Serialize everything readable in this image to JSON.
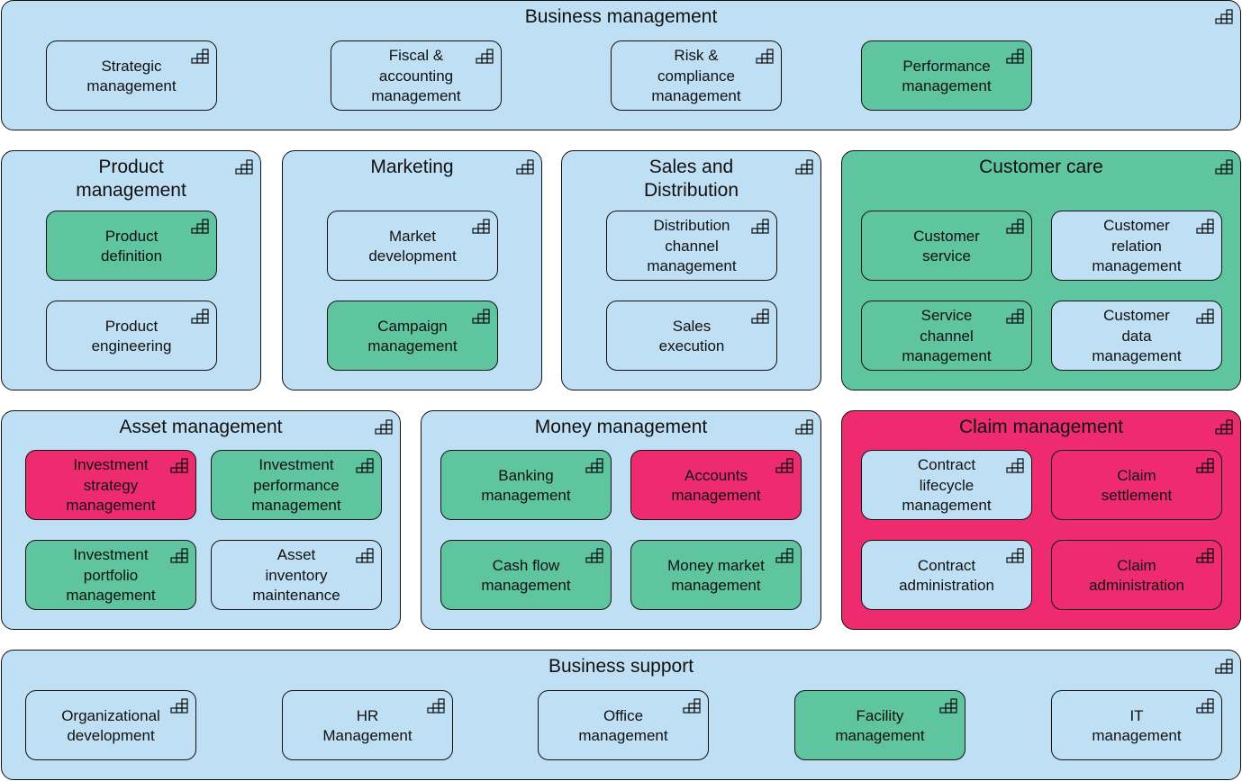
{
  "colors": {
    "default": "#bfe0f4",
    "highlight_green": "#5fc4a0",
    "highlight_red": "#ee2b6f"
  },
  "icon": "capability-staircase-icon",
  "groups": [
    {
      "title": "Business management",
      "state": "default",
      "items": [
        {
          "label": "Strategic\nmanagement",
          "state": "default"
        },
        {
          "label": "Fiscal &\naccounting\nmanagement",
          "state": "default"
        },
        {
          "label": "Risk &\ncompliance\nmanagement",
          "state": "default"
        },
        {
          "label": "Performance\nmanagement",
          "state": "green"
        }
      ]
    },
    {
      "title": "Product\nmanagement",
      "state": "default",
      "items": [
        {
          "label": "Product\ndefinition",
          "state": "green"
        },
        {
          "label": "Product\nengineering",
          "state": "default"
        }
      ]
    },
    {
      "title": "Marketing",
      "state": "default",
      "items": [
        {
          "label": "Market\ndevelopment",
          "state": "default"
        },
        {
          "label": "Campaign\nmanagement",
          "state": "green"
        }
      ]
    },
    {
      "title": "Sales and\nDistribution",
      "state": "default",
      "items": [
        {
          "label": "Distribution\nchannel\nmanagement",
          "state": "default"
        },
        {
          "label": "Sales\nexecution",
          "state": "default"
        }
      ]
    },
    {
      "title": "Customer care",
      "state": "green",
      "items": [
        {
          "label": "Customer\nservice",
          "state": "green"
        },
        {
          "label": "Customer\nrelation\nmanagement",
          "state": "default"
        },
        {
          "label": "Service\nchannel\nmanagement",
          "state": "green"
        },
        {
          "label": "Customer\ndata\nmanagement",
          "state": "default"
        }
      ]
    },
    {
      "title": "Asset management",
      "state": "default",
      "items": [
        {
          "label": "Investment\nstrategy\nmanagement",
          "state": "red"
        },
        {
          "label": "Investment\nperformance\nmanagement",
          "state": "green"
        },
        {
          "label": "Investment\nportfolio\nmanagement",
          "state": "green"
        },
        {
          "label": "Asset\ninventory\nmaintenance",
          "state": "default"
        }
      ]
    },
    {
      "title": "Money management",
      "state": "default",
      "items": [
        {
          "label": "Banking\nmanagement",
          "state": "green"
        },
        {
          "label": "Accounts\nmanagement",
          "state": "red"
        },
        {
          "label": "Cash flow\nmanagement",
          "state": "green"
        },
        {
          "label": "Money market\nmanagement",
          "state": "green"
        }
      ]
    },
    {
      "title": "Claim management",
      "state": "red",
      "items": [
        {
          "label": "Contract\nlifecycle\nmanagement",
          "state": "default"
        },
        {
          "label": "Claim\nsettlement",
          "state": "red"
        },
        {
          "label": "Contract\nadministration",
          "state": "default"
        },
        {
          "label": "Claim\nadministration",
          "state": "red"
        }
      ]
    },
    {
      "title": "Business support",
      "state": "default",
      "items": [
        {
          "label": "Organizational\ndevelopment",
          "state": "default"
        },
        {
          "label": "HR\nManagement",
          "state": "default"
        },
        {
          "label": "Office\nmanagement",
          "state": "default"
        },
        {
          "label": "Facility\nmanagement",
          "state": "green"
        },
        {
          "label": "IT\nmanagement",
          "state": "default"
        }
      ]
    }
  ]
}
